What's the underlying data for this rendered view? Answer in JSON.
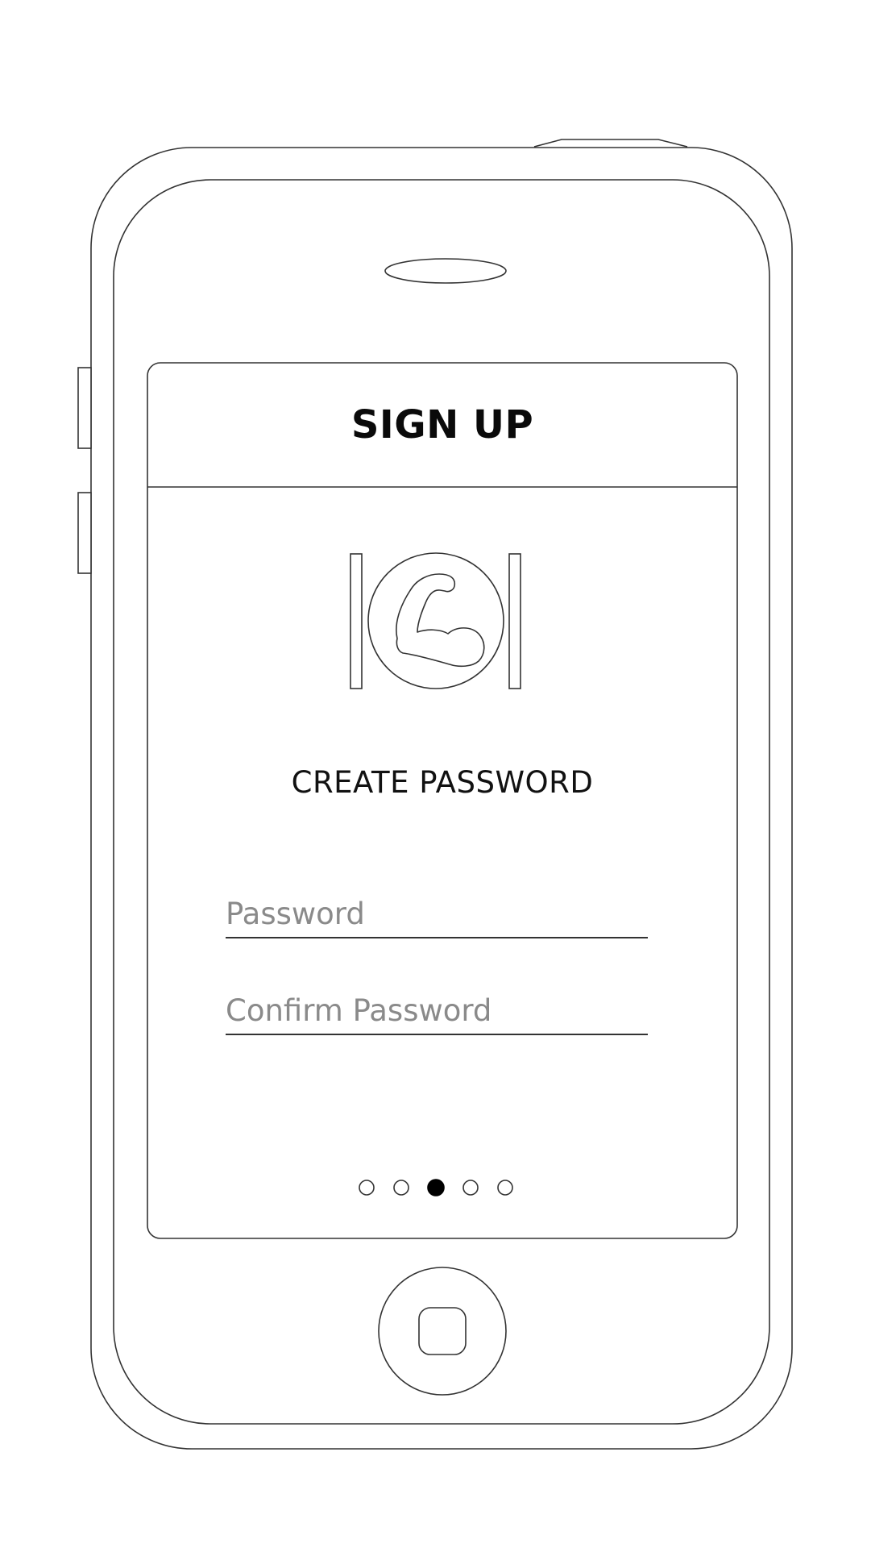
{
  "app": {
    "header_title": "SIGN UP",
    "logo_icon": "flexed-arm-icon"
  },
  "main": {
    "heading": "CREATE PASSWORD",
    "password_field": {
      "placeholder": "Password",
      "value": ""
    },
    "confirm_field": {
      "placeholder": "Confirm Password",
      "value": ""
    }
  },
  "pagination": {
    "total": 5,
    "active_index": 2
  },
  "colors": {
    "outline": "#333333",
    "placeholder": "#8a8a8a",
    "text": "#111111",
    "active_dot": "#000000"
  }
}
